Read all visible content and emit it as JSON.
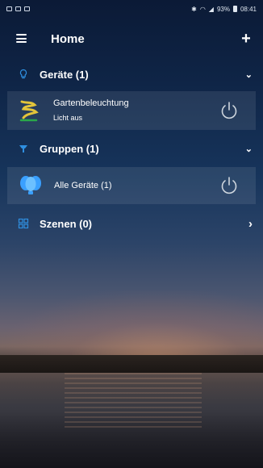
{
  "status_bar": {
    "time": "08:41",
    "battery": "93%"
  },
  "appbar": {
    "title": "Home",
    "add_icon": "+"
  },
  "sections": {
    "devices": {
      "label": "Geräte (1)",
      "chevron": "⌄"
    },
    "groups": {
      "label": "Gruppen (1)",
      "chevron": "⌄"
    },
    "scenes": {
      "label": "Szenen (0)",
      "chevron": "›"
    }
  },
  "devices": [
    {
      "name": "Gartenbeleuchtung",
      "status": "Licht aus"
    }
  ],
  "groups": [
    {
      "name": "Alle Geräte (1)"
    }
  ],
  "colors": {
    "accent_blue": "#2f8fe0",
    "device_icon_yellow": "#e3c43a",
    "device_icon_green": "#2aa84a",
    "group_icon_blue": "#3aa0ff"
  },
  "icons": {
    "menu": "menu-icon",
    "add": "plus-icon",
    "devices_section": "lightbulb-icon",
    "groups_section": "group-lights-icon",
    "scenes_section": "grid-icon",
    "device": "garden-light-icon",
    "group": "bulbs-icon",
    "power": "power-icon"
  }
}
